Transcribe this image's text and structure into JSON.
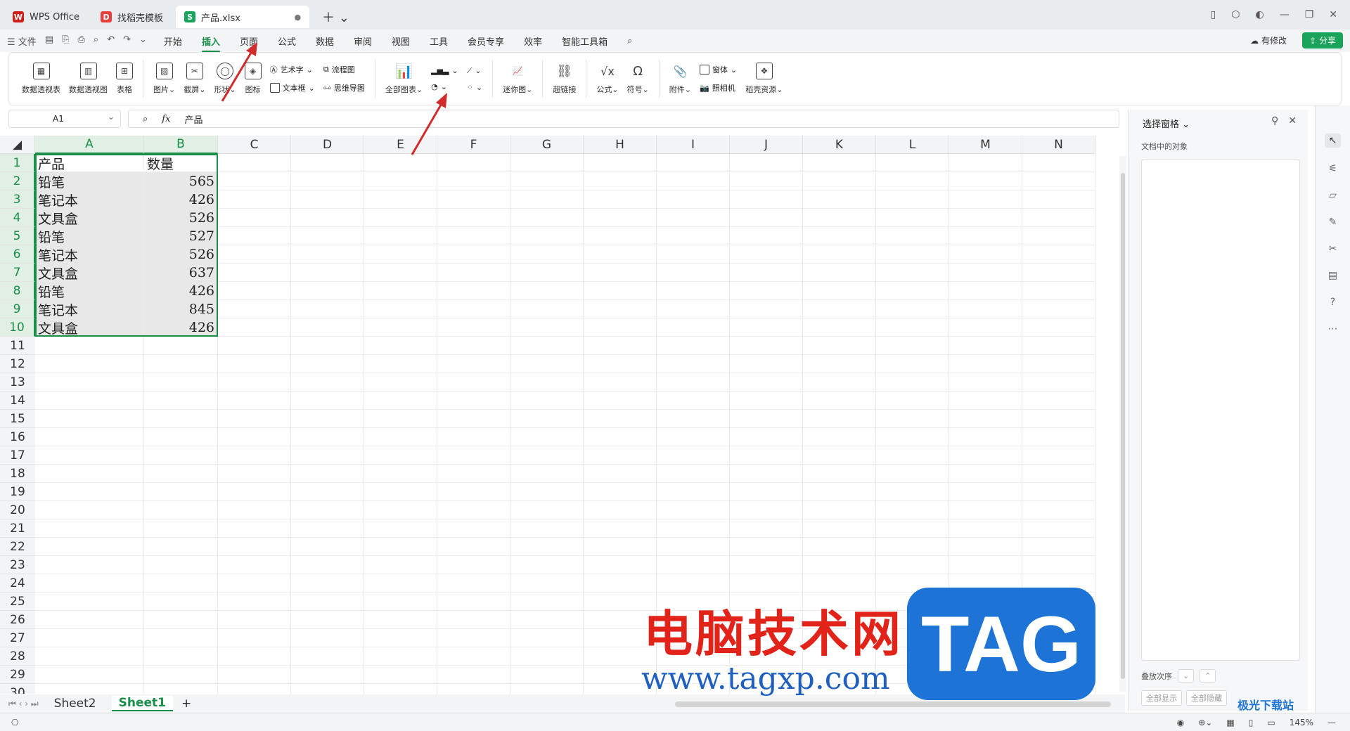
{
  "tabs": [
    {
      "label": "WPS Office",
      "logo": "W",
      "color": "#d0201b"
    },
    {
      "label": "找稻壳模板",
      "logo": "D",
      "color": "#e8403c"
    },
    {
      "label": "产品.xlsx",
      "logo": "S",
      "color": "#1aa35a"
    }
  ],
  "menu": {
    "file": "文件",
    "items": [
      "开始",
      "插入",
      "页面",
      "公式",
      "数据",
      "审阅",
      "视图",
      "工具",
      "会员专享",
      "效率",
      "智能工具箱"
    ],
    "active": "插入",
    "modified": "有修改",
    "share": "分享"
  },
  "ribbon": {
    "b1": "数据透视表",
    "b2": "数据透视图",
    "b3": "表格",
    "b4": "图片",
    "b5": "截屏",
    "b6": "形状",
    "b7": "图标",
    "art": "艺术字",
    "flow": "流程图",
    "textbox": "文本框",
    "mind": "思维导图",
    "allcharts": "全部图表",
    "spark": "迷你图",
    "link": "超链接",
    "formula": "公式",
    "symbol": "符号",
    "attach": "附件",
    "window": "窗体",
    "camera": "照相机",
    "resource": "稻壳资源"
  },
  "formula": {
    "cell": "A1",
    "fx": "fx",
    "value": "产品"
  },
  "columns": [
    "A",
    "B",
    "C",
    "D",
    "E",
    "F",
    "G",
    "H",
    "I",
    "J",
    "K",
    "L",
    "M",
    "N"
  ],
  "rows": [
    "1",
    "2",
    "3",
    "4",
    "5",
    "6",
    "7",
    "8",
    "9",
    "10",
    "11",
    "12",
    "13",
    "14",
    "15",
    "16",
    "17",
    "18",
    "19",
    "20",
    "21",
    "22",
    "23",
    "24",
    "25",
    "26",
    "27",
    "28",
    "29",
    "30"
  ],
  "data": [
    [
      "产品",
      "数量"
    ],
    [
      "铅笔",
      "565"
    ],
    [
      "笔记本",
      "426"
    ],
    [
      "文具盒",
      "526"
    ],
    [
      "铅笔",
      "527"
    ],
    [
      "笔记本",
      "526"
    ],
    [
      "文具盒",
      "637"
    ],
    [
      "铅笔",
      "426"
    ],
    [
      "笔记本",
      "845"
    ],
    [
      "文具盒",
      "426"
    ]
  ],
  "sheets": {
    "s1": "Sheet2",
    "s2": "Sheet1",
    "add": "+"
  },
  "panel": {
    "title": "选择窗格",
    "objects": "文档中的对象",
    "order": "叠放次序",
    "showAll": "全部显示",
    "hideAll": "全部隐藏"
  },
  "status": {
    "zoom": "145%"
  },
  "watermark": {
    "cn": "电脑技术网",
    "url": "www.tagxp.com",
    "tag": "TAG",
    "site": "极光下载站"
  }
}
